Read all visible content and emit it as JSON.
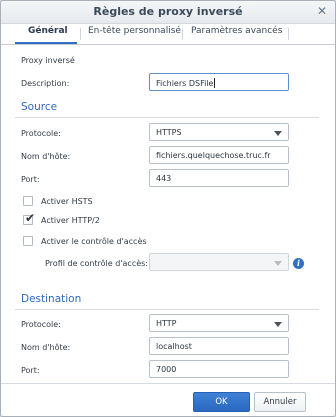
{
  "dialog": {
    "title": "Règles de proxy inversé",
    "close_icon": "close-icon"
  },
  "tabs": [
    {
      "label": "Général",
      "active": true
    },
    {
      "label": "En-tête personnalisé",
      "active": false
    },
    {
      "label": "Paramètres avancés",
      "active": false
    }
  ],
  "general": {
    "proxy_heading": "Proxy inversé",
    "description_label": "Description:",
    "description_value": "Fichiers DSFile"
  },
  "source": {
    "heading": "Source",
    "protocol_label": "Protocole:",
    "protocol_value": "HTTPS",
    "hostname_label": "Nom d'hôte:",
    "hostname_value": "fichiers.quelquechose.truc.fr",
    "port_label": "Port:",
    "port_value": "443",
    "hsts_label": "Activer HSTS",
    "hsts_checked": false,
    "http2_label": "Activer HTTP/2",
    "http2_checked": true,
    "access_control_label": "Activer le contrôle d'accès",
    "access_control_checked": false,
    "access_profile_label": "Profil de contrôle d'accès:",
    "access_profile_value": ""
  },
  "destination": {
    "heading": "Destination",
    "protocol_label": "Protocole:",
    "protocol_value": "HTTP",
    "hostname_label": "Nom d'hôte:",
    "hostname_value": "localhost",
    "port_label": "Port:",
    "port_value": "7000"
  },
  "footer": {
    "ok_label": "OK",
    "cancel_label": "Annuler"
  },
  "colors": {
    "accent": "#2f6fc4",
    "section_heading": "#2e6bbd"
  }
}
